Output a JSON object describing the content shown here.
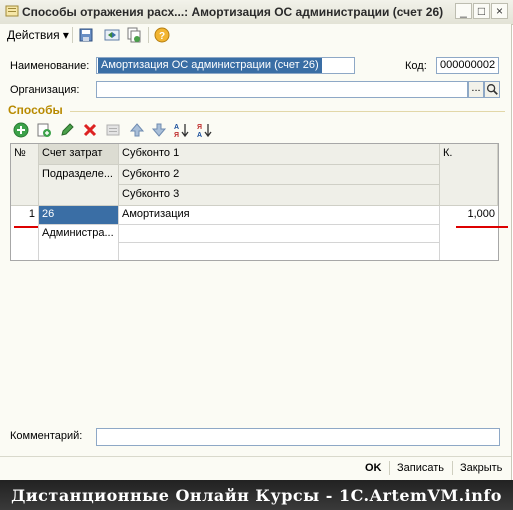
{
  "window": {
    "title": "Способы отражения расх...: Амортизация ОС администрации (счет 26)",
    "buttons": {
      "minimize": "_",
      "maximize": "□",
      "close": "×"
    }
  },
  "toolbar": {
    "actions_label": "Действия ▾",
    "icons": [
      "save-close-icon",
      "refresh-icon",
      "copy-icon",
      "help-icon"
    ]
  },
  "form": {
    "name_label": "Наименование:",
    "name_value": "Амортизация ОС администрации (счет 26)",
    "code_label": "Код:",
    "code_value": "000000002",
    "org_label": "Организация:",
    "org_value": "",
    "org_choose": "...",
    "section_title": "Способы"
  },
  "table_toolbar": {
    "icons": [
      "add-icon",
      "copy-row-icon",
      "edit-icon",
      "delete-icon",
      "fill-icon",
      "move-up-icon",
      "move-down-icon",
      "sort-asc-icon",
      "sort-desc-icon"
    ]
  },
  "table": {
    "headers": {
      "num": "№",
      "account": "Счет затрат",
      "dept": "Подразделе...",
      "sub1": "Субконто 1",
      "sub2": "Субконто 2",
      "sub3": "Субконто 3",
      "coef": "К."
    },
    "rows": [
      {
        "num": "1",
        "account": "26",
        "dept": "Администра...",
        "sub1": "Амортизация",
        "sub2": "",
        "sub3": "",
        "coef": "1,000"
      }
    ]
  },
  "footer": {
    "comment_label": "Комментарий:",
    "comment_value": "",
    "ok_label": "OK",
    "save_label": "Записать",
    "close_label": "Закрыть"
  },
  "banner": {
    "text": "Дистанционные Онлайн Курсы - 1C.ArtemVM.info"
  },
  "colors": {
    "accent": "#3a6ea5",
    "section": "#b88a00",
    "marker": "#dd0000"
  }
}
